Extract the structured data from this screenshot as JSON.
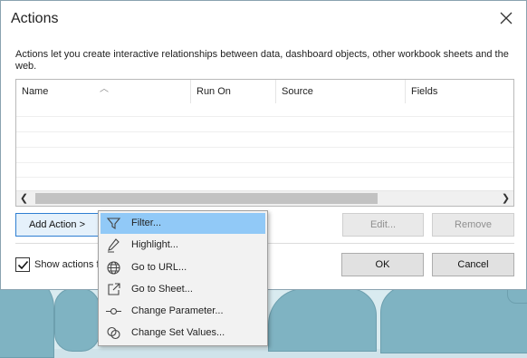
{
  "dialog": {
    "title": "Actions",
    "description": "Actions let you create interactive relationships between data, dashboard objects, other workbook sheets and the web."
  },
  "table": {
    "columns": [
      "Name",
      "Run On",
      "Source",
      "Fields"
    ],
    "rows": []
  },
  "buttons": {
    "add_action": "Add Action >",
    "edit": "Edit...",
    "remove": "Remove",
    "ok": "OK",
    "cancel": "Cancel"
  },
  "checkbox": {
    "label": "Show actions f",
    "checked": true
  },
  "menu": {
    "items": [
      {
        "label": "Filter...",
        "icon": "filter-icon",
        "selected": true
      },
      {
        "label": "Highlight...",
        "icon": "highlight-icon",
        "selected": false
      },
      {
        "label": "Go to URL...",
        "icon": "globe-icon",
        "selected": false
      },
      {
        "label": "Go to Sheet...",
        "icon": "go-to-sheet-icon",
        "selected": false
      },
      {
        "label": "Change Parameter...",
        "icon": "parameter-icon",
        "selected": false
      },
      {
        "label": "Change Set Values...",
        "icon": "set-values-icon",
        "selected": false
      }
    ]
  },
  "colors": {
    "menu_highlight": "#91c9f7",
    "focus_border": "#2f7fd2"
  }
}
